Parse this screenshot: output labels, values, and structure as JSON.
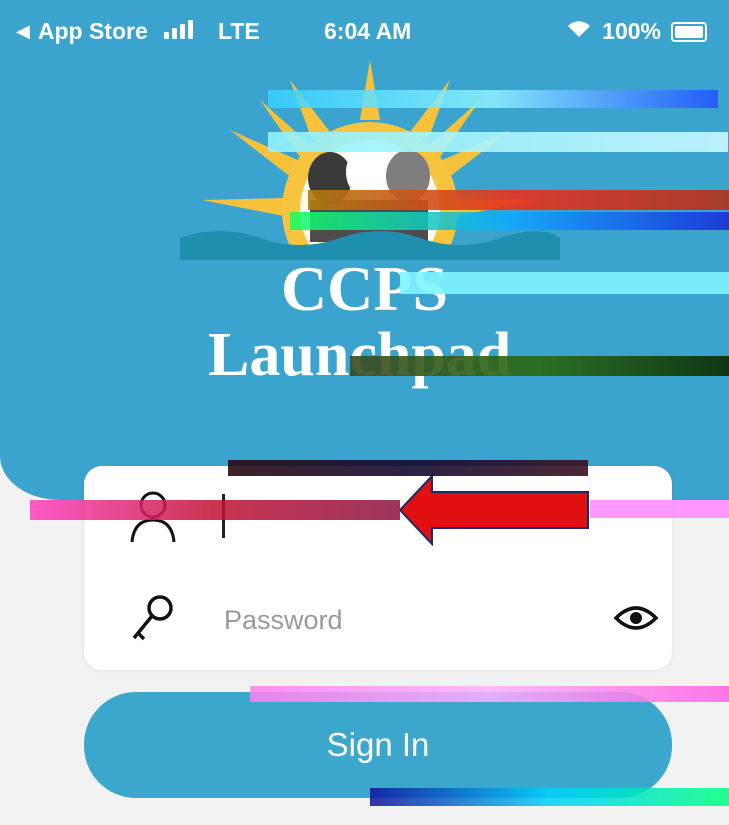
{
  "status_bar": {
    "back_label": "App Store",
    "network": "LTE",
    "time": "6:04 AM",
    "battery": "100%"
  },
  "app": {
    "title_line1": "CCPS",
    "title_line2": "Launchpad"
  },
  "login": {
    "username_placeholder": "",
    "password_placeholder": "Password",
    "sign_in_label": "Sign In"
  },
  "icons": {
    "back": "back-triangle-icon",
    "user": "user-icon",
    "key": "key-icon",
    "eye": "eye-icon",
    "arrow": "red-arrow-annotation"
  },
  "colors": {
    "hero": "#3aa4cf",
    "button": "#3ca7cc",
    "arrow": "#e01010",
    "sun": "#f6c23b"
  }
}
